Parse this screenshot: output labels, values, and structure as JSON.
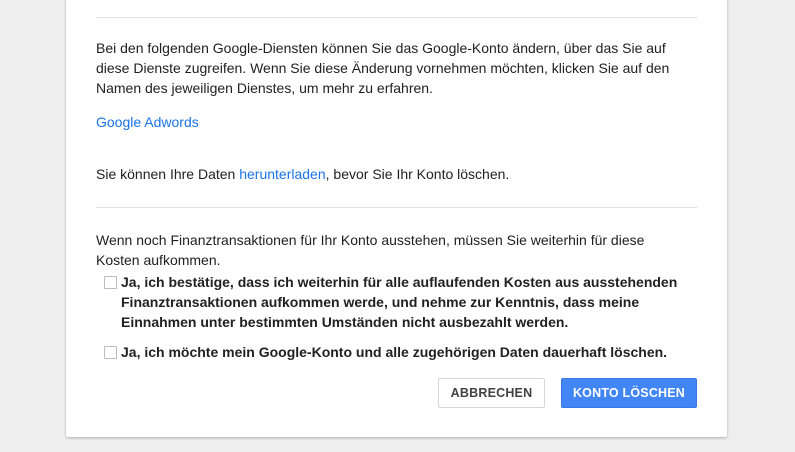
{
  "intro": {
    "text": "Bei den folgenden Google-Diensten können Sie das Google-Konto ändern, über das Sie auf diese Dienste zugreifen. Wenn Sie diese Änderung vornehmen möchten, klicken Sie auf den Namen des jeweiligen Dienstes, um mehr zu erfahren."
  },
  "services": [
    {
      "label": "Google Adwords"
    }
  ],
  "download": {
    "before": "Sie können Ihre Daten ",
    "link": "herunterladen",
    "after": ", bevor Sie Ihr Konto löschen."
  },
  "finance": {
    "text": "Wenn noch Finanztransaktionen für Ihr Konto ausstehen, müssen Sie weiterhin für diese Kosten aufkommen."
  },
  "checkboxes": [
    {
      "label": "Ja, ich bestätige, dass ich weiterhin für alle auflaufenden Kosten aus ausstehenden Finanztransaktionen aufkommen werde, und nehme zur Kenntnis, dass meine Einnahmen unter bestimmten Umständen nicht ausbezahlt werden.",
      "checked": false
    },
    {
      "label": "Ja, ich möchte mein Google-Konto und alle zugehörigen Daten dauerhaft löschen.",
      "checked": false
    }
  ],
  "buttons": {
    "cancel_label": "ABBRECHEN",
    "delete_label": "KONTO LÖSCHEN"
  },
  "colors": {
    "link": "#1a73e8",
    "primary_button": "#4285f4",
    "background": "#eeeeee"
  }
}
